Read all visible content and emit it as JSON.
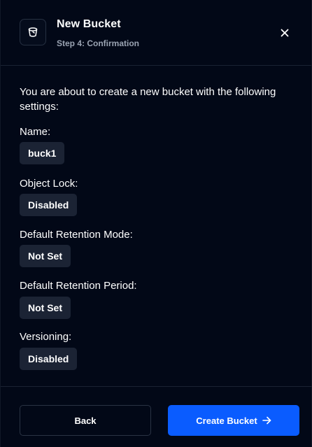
{
  "header": {
    "title": "New Bucket",
    "subtitle": "Step 4: Confirmation",
    "icon": "bucket-icon",
    "close_icon": "close-icon"
  },
  "body": {
    "intro": "You are about to create a new bucket with the following settings:",
    "fields": [
      {
        "label": "Name:",
        "value": "buck1"
      },
      {
        "label": "Object Lock:",
        "value": "Disabled"
      },
      {
        "label": "Default Retention Mode:",
        "value": "Not Set"
      },
      {
        "label": "Default Retention Period:",
        "value": "Not Set"
      },
      {
        "label": "Versioning:",
        "value": "Disabled"
      }
    ]
  },
  "footer": {
    "back_label": "Back",
    "create_label": "Create Bucket",
    "create_icon": "arrow-right-icon"
  },
  "colors": {
    "background": "#020817",
    "accent": "#0a5cff",
    "badge": "#1b2334",
    "muted_text": "#9aa3b2"
  }
}
